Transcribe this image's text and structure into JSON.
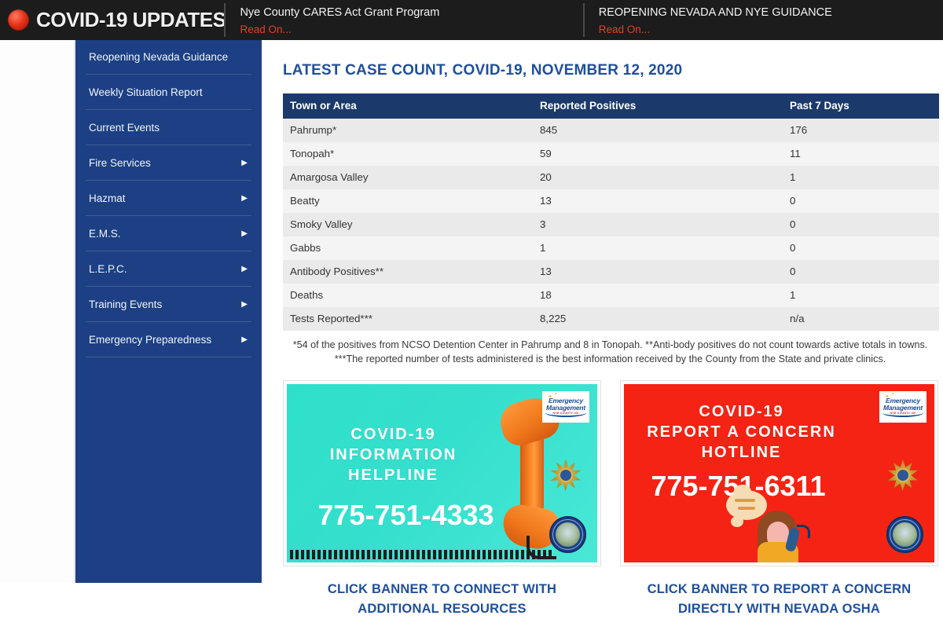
{
  "topbar": {
    "brand": "COVID-19 UPDATES",
    "alert_icon": "red-alert-dot-icon",
    "items": [
      {
        "headline": "Nye County CARES Act Grant Program",
        "link": "Read On..."
      },
      {
        "headline": "REOPENING NEVADA AND NYE GUIDANCE",
        "link": "Read On..."
      }
    ]
  },
  "sidebar": {
    "items": [
      {
        "label": "Reopening Nevada Guidance",
        "caret": ""
      },
      {
        "label": "Weekly Situation Report",
        "caret": ""
      },
      {
        "label": "Current Events",
        "caret": ""
      },
      {
        "label": "Fire Services",
        "caret": "▶"
      },
      {
        "label": "Hazmat",
        "caret": "▶"
      },
      {
        "label": "E.M.S.",
        "caret": "▶"
      },
      {
        "label": "L.E.P.C.",
        "caret": "▶"
      },
      {
        "label": "Training Events",
        "caret": "▶"
      },
      {
        "label": "Emergency Preparedness",
        "caret": "▶"
      }
    ]
  },
  "main": {
    "title": "LATEST CASE COUNT, COVID-19, NOVEMBER 12, 2020",
    "table": {
      "headers": [
        "Town or Area",
        "Reported Positives",
        "Past 7 Days"
      ],
      "rows": [
        [
          "Pahrump*",
          "845",
          "176"
        ],
        [
          "Tonopah*",
          "59",
          "11"
        ],
        [
          "Amargosa Valley",
          "20",
          "1"
        ],
        [
          "Beatty",
          "13",
          "0"
        ],
        [
          "Smoky Valley",
          "3",
          "0"
        ],
        [
          "Gabbs",
          "1",
          "0"
        ],
        [
          "Antibody Positives**",
          "13",
          "0"
        ],
        [
          "Deaths",
          "18",
          "1"
        ],
        [
          "Tests Reported***",
          "8,225",
          "n/a"
        ]
      ]
    },
    "footnote": "*54 of the positives from NCSO Detention Center in Pahrump and 8 in Tonopah. **Anti-body positives do not count towards active totals in towns. ***The reported number of tests administered is the best information received by the County from the State and private clinics.",
    "banners": [
      {
        "theme_color": "#2fe0cb",
        "line1": "COVID-19",
        "line2": "INFORMATION",
        "line3": "HELPLINE",
        "phone": "775-751-4333",
        "logo_line1": "Emergency",
        "logo_line2": "Management",
        "logo_line3": "NYE COUNTY, NV",
        "caption": "CLICK BANNER TO CONNECT WITH ADDITIONAL RESOURCES"
      },
      {
        "theme_color": "#f42314",
        "line1": "COVID-19",
        "line2": "REPORT A CONCERN",
        "line3": "HOTLINE",
        "phone": "775-751-6311",
        "logo_line1": "Emergency",
        "logo_line2": "Management",
        "logo_line3": "NYE COUNTY, NV",
        "caption": "CLICK BANNER TO REPORT A CONCERN DIRECTLY WITH NEVADA OSHA"
      }
    ],
    "captions": [
      {
        "l1": "CLICK BANNER TO CONNECT WITH",
        "l2": "ADDITIONAL RESOURCES"
      },
      {
        "l1": "CLICK BANNER TO REPORT A CONCERN",
        "l2": "DIRECTLY WITH NEVADA OSHA"
      }
    ]
  },
  "colors": {
    "sidebar_blue": "#1c4083",
    "table_header_blue": "#1b3a6b",
    "link_blue": "#1f4f9c",
    "topbar_black": "#1c1c1c",
    "read_on_red": "#e2402b"
  }
}
